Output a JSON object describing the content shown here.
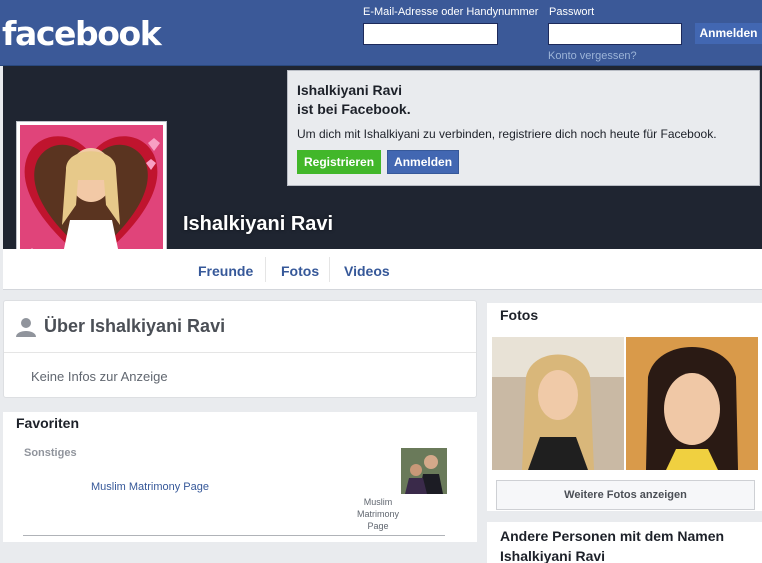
{
  "header": {
    "logo": "facebook",
    "email_label": "E-Mail-Adresse oder Handynummer",
    "password_label": "Passwort",
    "login_button": "Anmelden",
    "forgot_link": "Konto vergessen?",
    "brand_color": "#3b5998"
  },
  "signup_box": {
    "name": "Ishalkiyani Ravi",
    "subtitle": "ist bei Facebook.",
    "text": "Um dich mit Ishalkiyani zu verbinden, registriere dich noch heute für Facebook.",
    "register_button": "Registrieren",
    "login_button": "Anmelden"
  },
  "profile": {
    "name": "Ishalkiyani Ravi"
  },
  "tabs": [
    "Freunde",
    "Fotos",
    "Videos"
  ],
  "about": {
    "title": "Über Ishalkiyani Ravi",
    "icon": "person-icon",
    "empty_text": "Keine Infos zur Anzeige"
  },
  "favorites": {
    "title": "Favoriten",
    "category": "Sonstiges",
    "link": "Muslim Matrimony Page",
    "thumb_label": "Muslim Matrimony Page"
  },
  "photos": {
    "title": "Fotos",
    "more_button": "Weitere Fotos anzeigen"
  },
  "others": {
    "title": "Andere Personen mit dem Namen Ishalkiyani Ravi"
  }
}
